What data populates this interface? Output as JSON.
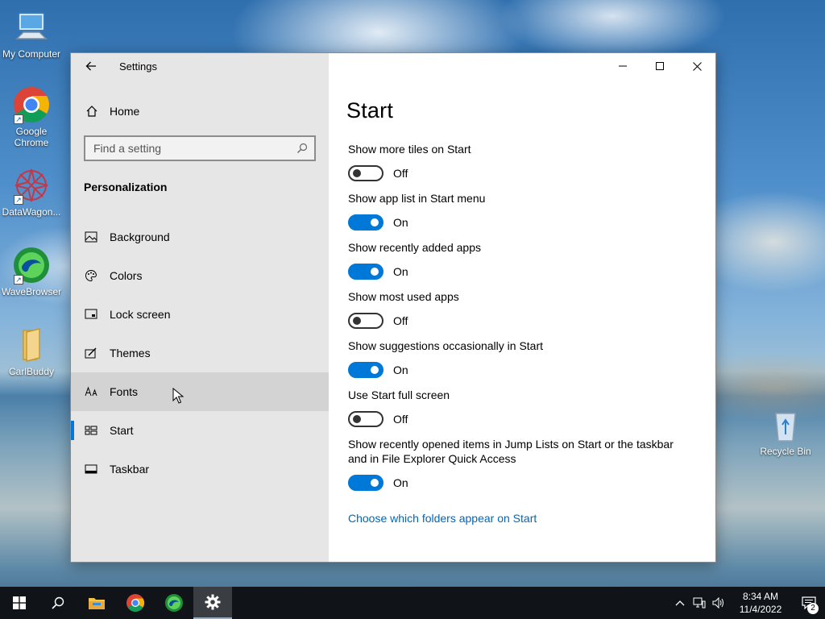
{
  "desktop": {
    "icons": [
      {
        "label": "My Computer",
        "icon": "computer-icon"
      },
      {
        "label": "Google Chrome",
        "icon": "chrome-icon"
      },
      {
        "label": "DataWagon...",
        "icon": "datawagon-icon"
      },
      {
        "label": "WaveBrowser",
        "icon": "wavebrowser-icon"
      },
      {
        "label": "CarlBuddy",
        "icon": "folder-icon"
      },
      {
        "label": "Recycle Bin",
        "icon": "recycle-bin-icon"
      }
    ]
  },
  "window": {
    "title": "Settings",
    "sidebar": {
      "home_label": "Home",
      "search_placeholder": "Find a setting",
      "section_title": "Personalization",
      "items": [
        {
          "label": "Background",
          "icon": "background-icon"
        },
        {
          "label": "Colors",
          "icon": "colors-icon"
        },
        {
          "label": "Lock screen",
          "icon": "lock-screen-icon"
        },
        {
          "label": "Themes",
          "icon": "themes-icon"
        },
        {
          "label": "Fonts",
          "icon": "fonts-icon"
        },
        {
          "label": "Start",
          "icon": "start-icon"
        },
        {
          "label": "Taskbar",
          "icon": "taskbar-icon"
        }
      ],
      "hovered_item": "Fonts",
      "selected_item": "Start"
    },
    "page": {
      "title": "Start",
      "settings": [
        {
          "label": "Show more tiles on Start",
          "state": "Off"
        },
        {
          "label": "Show app list in Start menu",
          "state": "On"
        },
        {
          "label": "Show recently added apps",
          "state": "On"
        },
        {
          "label": "Show most used apps",
          "state": "Off"
        },
        {
          "label": "Show suggestions occasionally in Start",
          "state": "On"
        },
        {
          "label": "Use Start full screen",
          "state": "Off"
        },
        {
          "label": "Show recently opened items in Jump Lists on Start or the taskbar and in File Explorer Quick Access",
          "state": "On"
        }
      ],
      "link": "Choose which folders appear on Start"
    }
  },
  "taskbar": {
    "clock_time": "8:34 AM",
    "clock_date": "11/4/2022",
    "notification_count": "2"
  },
  "colors": {
    "accent": "#0078d7",
    "link": "#0067b8",
    "sidebar_bg": "#e6e6e6",
    "taskbar_bg": "#101418"
  }
}
